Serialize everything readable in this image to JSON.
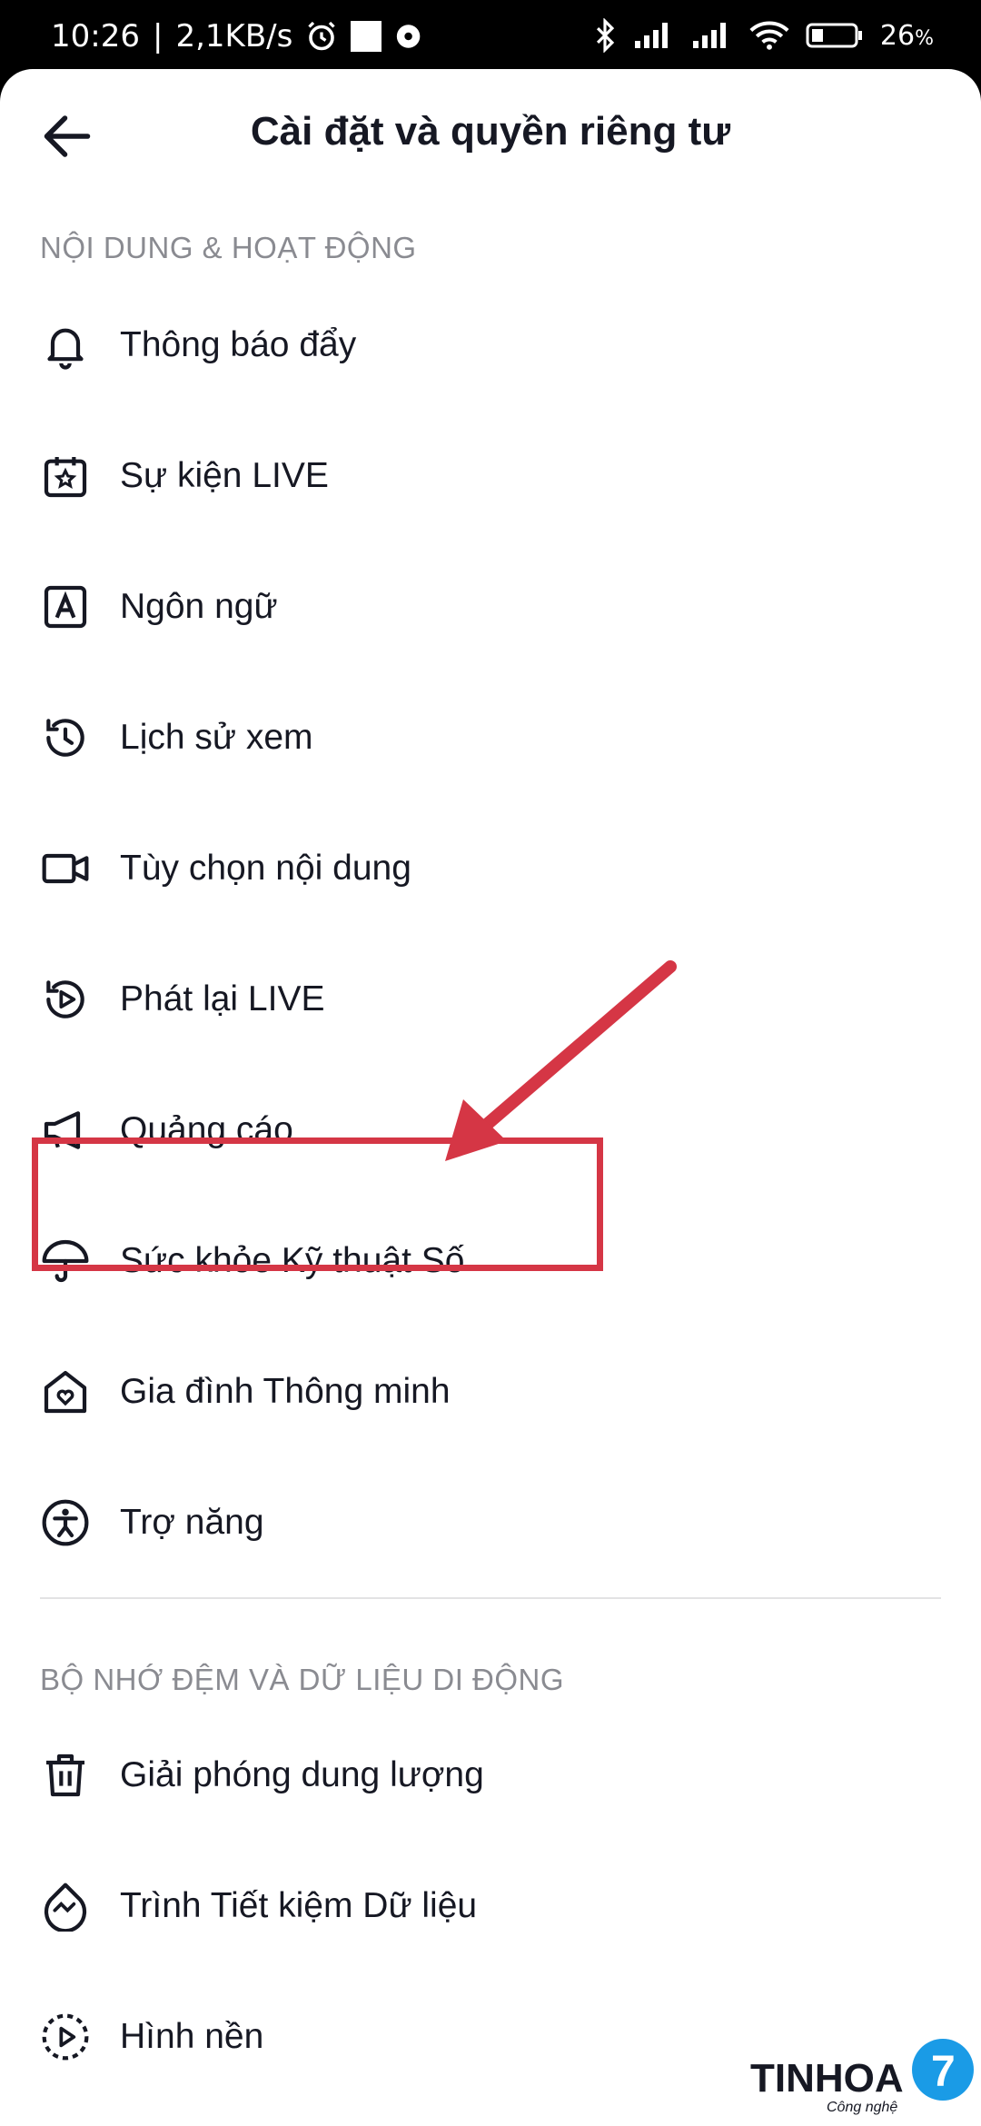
{
  "status_bar": {
    "time": "10:26",
    "separator": "|",
    "speed": "2,1KB/s",
    "battery": "26",
    "battery_unit": "%"
  },
  "header": {
    "title": "Cài đặt và quyền riêng tư"
  },
  "sections": [
    {
      "title": "NỘI DUNG & HOẠT ĐỘNG",
      "items": [
        {
          "label": "Thông báo đẩy",
          "icon": "bell-icon"
        },
        {
          "label": "Sự kiện LIVE",
          "icon": "calendar-star-icon"
        },
        {
          "label": "Ngôn ngữ",
          "icon": "language-icon"
        },
        {
          "label": "Lịch sử xem",
          "icon": "history-icon"
        },
        {
          "label": "Tùy chọn nội dung",
          "icon": "video-camera-icon"
        },
        {
          "label": "Phát lại LIVE",
          "icon": "replay-icon"
        },
        {
          "label": "Quảng cáo",
          "icon": "megaphone-icon"
        },
        {
          "label": "Sức khỏe Kỹ thuật Số",
          "icon": "umbrella-icon"
        },
        {
          "label": "Gia đình Thông minh",
          "icon": "home-heart-icon"
        },
        {
          "label": "Trợ năng",
          "icon": "accessibility-icon"
        }
      ]
    },
    {
      "title": "BỘ NHỚ ĐỆM VÀ DỮ LIỆU DI ĐỘNG",
      "items": [
        {
          "label": "Giải phóng dung lượng",
          "icon": "trash-icon"
        },
        {
          "label": "Trình Tiết kiệm Dữ liệu",
          "icon": "data-saver-icon"
        },
        {
          "label": "Hình nền",
          "icon": "wallpaper-icon"
        }
      ]
    }
  ],
  "watermark": {
    "brand": "TINHOA",
    "number": "7",
    "tagline": "Công nghệ"
  },
  "colors": {
    "text": "#161823",
    "section": "#8a8b91",
    "highlight": "#d53645",
    "watermark_blue": "#1a9be6"
  }
}
